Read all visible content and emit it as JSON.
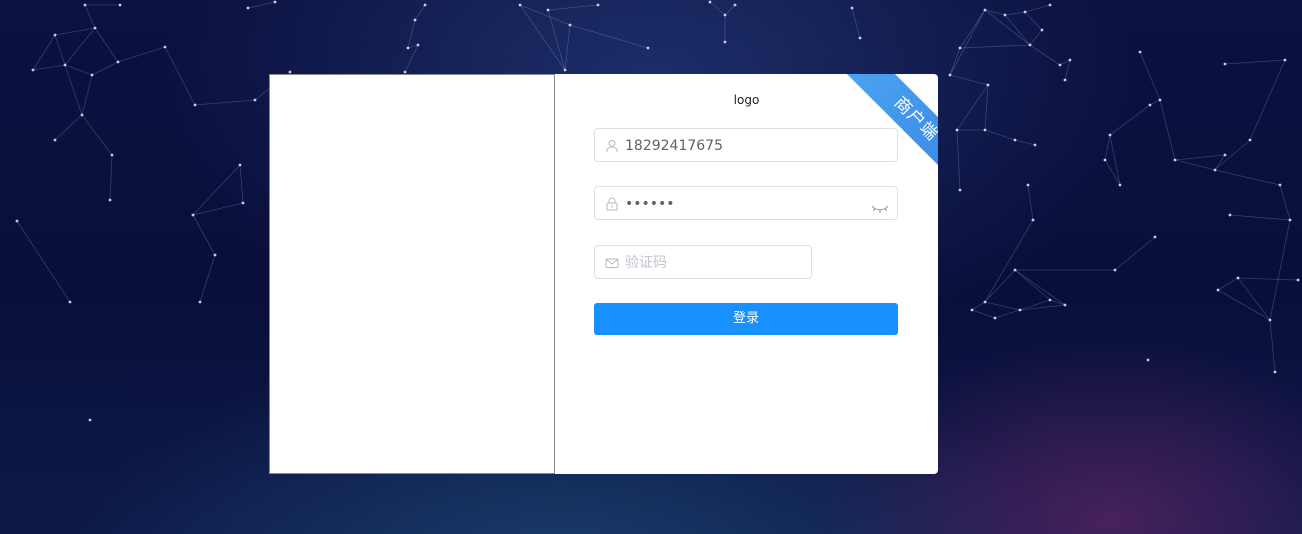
{
  "login": {
    "logo_text": "logo",
    "ribbon_text": "商户端",
    "username": {
      "value": "18292417675",
      "icon": "user-icon"
    },
    "password": {
      "value": "••••••",
      "icon": "lock-icon",
      "toggle_icon": "eye-closed-icon"
    },
    "captcha": {
      "placeholder": "验证码",
      "value": "",
      "icon": "mail-icon"
    },
    "submit_label": "登录"
  },
  "colors": {
    "primary": "#1890ff",
    "ribbon_start": "#4aa4f0",
    "ribbon_end": "#3b86e6",
    "background_dark": "#0a0e3a"
  }
}
